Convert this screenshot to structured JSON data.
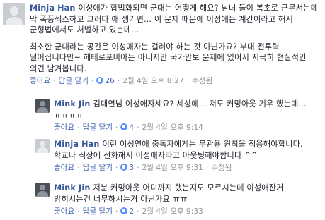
{
  "comments": [
    {
      "author": "Minja Han",
      "paragraphs": [
        "이성애가 합법화되면 군대는 어떻게 해요? 남녀 둘이 복초로 근무서는데 막 폭풍섹스하고 그러다 애 생기면... 이 문제 때문에 이성애는 계간이라고 해서 군형법에서도 처벌하고 있는데...",
        "최소한 군대라는 공간은 이성애자는 걸러야 하는 것 아닌가요? 부대 전투력 떨어집니다만~ 헤테로포비아는 아니지만 국가안보 문제에 있어서 지극히 현실적인 의견 남겨봅니다."
      ],
      "actions": {
        "like": "좋아요",
        "reply": "답글 달기",
        "like_count": "26",
        "time": "2월 4일 오후 8:27",
        "edited": "수정됨"
      }
    },
    {
      "author": "Mink Jin",
      "paragraphs": [
        "김대연님 이성애자세요? 세상에... 저도 커밍아웃 겨우 했는데... ㅠㅠㅠㅠ"
      ],
      "actions": {
        "like": "좋아요",
        "reply": "답글 달기",
        "like_count": "4",
        "time": "2월 4일 오후 9:14"
      }
    },
    {
      "author": "Minja Han",
      "paragraphs": [
        "이런 이성연애 중독자에게는 무관용 원칙을 적용해야합니다. 학교나 직장에 전화해서 이성애자라고 아웃팅해야합니다 ^^"
      ],
      "actions": {
        "like": "좋아요",
        "reply": "답글 달기",
        "like_count": "3",
        "time": "2월 4일 오후 9:31",
        "edited": "수정됨"
      }
    },
    {
      "author": "Mink Jin",
      "paragraphs": [
        "저분 커밍아웃 어디까지 했는지도 모르시는데 이성애잔거 밝히시는건 너무하시는거 아닌가요 ㅠㅠ"
      ],
      "actions": {
        "like": "좋아요",
        "reply": "답글 달기",
        "like_count": "2",
        "time": "2월 4일 오후 9:33"
      }
    }
  ]
}
